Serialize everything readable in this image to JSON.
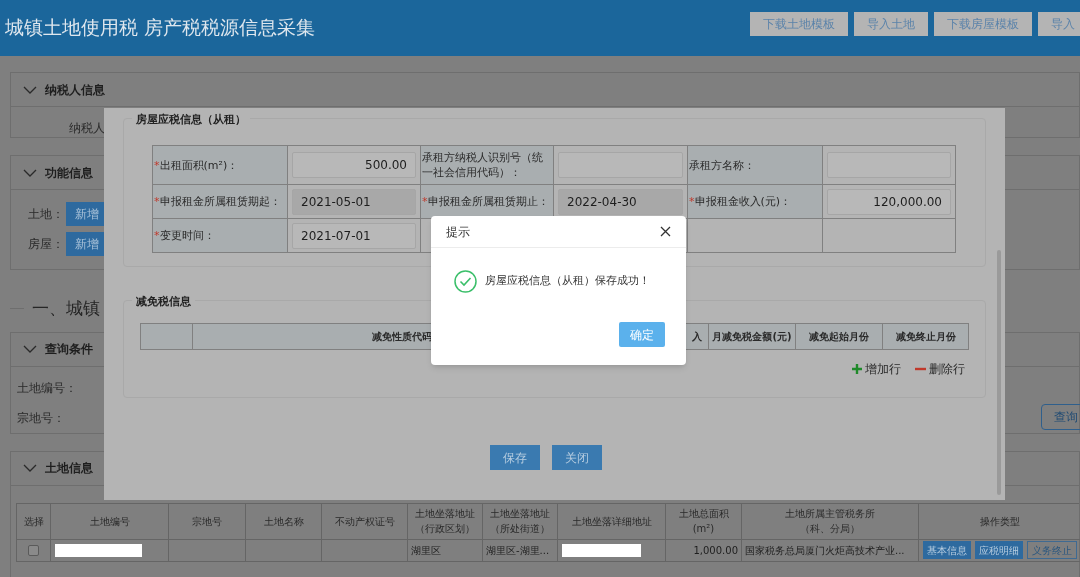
{
  "header": {
    "title": "城镇土地使用税 房产税税源信息采集",
    "buttons": [
      "下载土地模板",
      "导入土地",
      "下载房屋模板",
      "导入"
    ]
  },
  "taxpayer_panel": {
    "title": "纳税人信息",
    "label": "纳税人"
  },
  "function_panel": {
    "title": "功能信息",
    "rows": [
      {
        "label": "土地：",
        "button": "新增"
      },
      {
        "label": "房屋：",
        "button": "新增"
      }
    ]
  },
  "section_heading": "一、城镇",
  "query_panel": {
    "title": "查询条件",
    "fields": [
      "土地编号：",
      "宗地号："
    ],
    "button": "查询"
  },
  "land_panel": {
    "title": "土地信息",
    "table": {
      "columns": [
        "选择",
        "土地编号",
        "宗地号",
        "土地名称",
        "不动产权证号",
        "土地坐落地址（行政区划）",
        "土地坐落地址（所处街道）",
        "土地坐落详细地址",
        "土地总面积(m²)",
        "土地所属主管税务所（科、分局）",
        "操作类型"
      ],
      "rows": [
        {
          "cells": [
            {
              "kind": "checkbox",
              "checked": false
            },
            {
              "kind": "redacted"
            },
            {
              "kind": "text",
              "text": ""
            },
            {
              "kind": "text",
              "text": ""
            },
            {
              "kind": "text",
              "text": ""
            },
            {
              "kind": "text",
              "text": "湖里区"
            },
            {
              "kind": "text",
              "text": "湖里区-湖里..."
            },
            {
              "kind": "redacted"
            },
            {
              "kind": "number",
              "text": "1,000.00"
            },
            {
              "kind": "text",
              "text": "国家税务总局厦门火炬高技术产业..."
            },
            {
              "kind": "actions",
              "actions": [
                {
                  "kind": "filled",
                  "label": "基本信息"
                },
                {
                  "kind": "filled",
                  "label": "应税明细"
                },
                {
                  "kind": "outline",
                  "label": "义务终止"
                }
              ]
            }
          ]
        }
      ]
    }
  },
  "modal": {
    "rental_section": {
      "title": "房屋应税信息（从租）",
      "rows": [
        [
          {
            "kind": "label",
            "mark": "*",
            "text": "出租面积(m²)："
          },
          {
            "kind": "field",
            "numeric": true,
            "value": "500.00",
            "disabled": false
          },
          {
            "kind": "label",
            "text": "承租方纳税人识别号（统一社会信用代码）："
          },
          {
            "kind": "field",
            "disabled": false
          },
          {
            "kind": "label",
            "text": "承租方名称："
          },
          {
            "kind": "field",
            "disabled": false
          }
        ],
        [
          {
            "kind": "label",
            "mark": "*",
            "text": "申报租金所属租赁期起："
          },
          {
            "kind": "field",
            "numeric": false,
            "value": "2021-05-01",
            "disabled": true
          },
          {
            "kind": "label",
            "mark": "*",
            "text": "申报租金所属租赁期止："
          },
          {
            "kind": "field",
            "numeric": false,
            "value": "2022-04-30",
            "disabled": true
          },
          {
            "kind": "label",
            "mark": "*",
            "text": "申报租金收入(元)："
          },
          {
            "kind": "field",
            "numeric": true,
            "value": "120,000.00",
            "disabled": false
          }
        ],
        [
          {
            "kind": "label",
            "mark": "*",
            "text": "变更时间："
          },
          {
            "kind": "field",
            "numeric": false,
            "value": "2021-07-01",
            "disabled": false
          },
          {
            "kind": "blank"
          },
          {
            "kind": "blank"
          },
          {
            "kind": "blank"
          },
          {
            "kind": "blank"
          }
        ]
      ]
    },
    "exemption_section": {
      "title": "减免税信息",
      "columns": [
        "减免性质代码",
        "入",
        "月减免税金额(元)",
        "减免起始月份",
        "减免终止月份"
      ],
      "actions": [
        {
          "kind": "add",
          "label": "增加行"
        },
        {
          "kind": "remove",
          "label": "删除行"
        }
      ]
    },
    "buttons": [
      "保存",
      "关闭"
    ]
  },
  "dialog": {
    "title": "提示",
    "message": "房屋应税信息（从租）保存成功！",
    "confirm": "确定"
  }
}
